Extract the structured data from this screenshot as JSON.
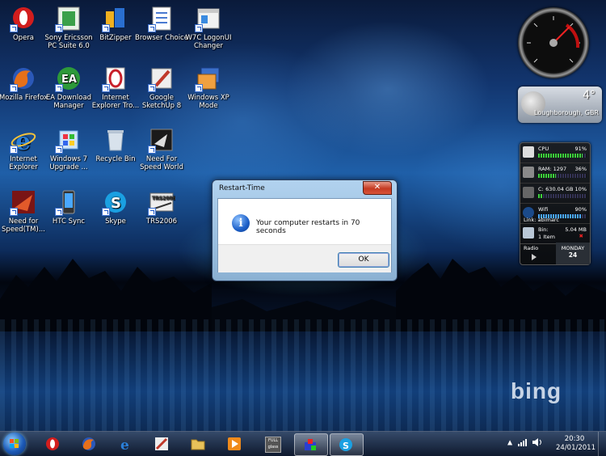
{
  "desktop": {
    "icons": [
      {
        "label": "Opera",
        "color": "#d21d1d"
      },
      {
        "label": "Sony Ericsson PC Suite 6.0",
        "color": "#3aa04a"
      },
      {
        "label": "BitZipper",
        "color": "#f0b020"
      },
      {
        "label": "Browser Choice",
        "color": "#4a7ad0"
      },
      {
        "label": "W7C LogonUI Changer",
        "color": "#c9c9c9"
      },
      {
        "label": "Mozilla Firefox",
        "color": "#e7701a"
      },
      {
        "label": "EA Download Manager",
        "color": "#2d9a3a"
      },
      {
        "label": "Internet Explorer Tro...",
        "color": "#c8202a"
      },
      {
        "label": "Google SketchUp 8",
        "color": "#c0392b"
      },
      {
        "label": "Windows XP Mode",
        "color": "#3b6fc9"
      },
      {
        "label": "Internet Explorer",
        "color": "#2a7fd8"
      },
      {
        "label": "Windows 7 Upgrade ...",
        "color": "#6fa8e8"
      },
      {
        "label": "Recycle Bin",
        "color": "#b9c7d6"
      },
      {
        "label": "Need For Speed World",
        "color": "#222222"
      },
      {
        "label": "Need for Speed(TM)...",
        "color": "#a62a2a"
      },
      {
        "label": "HTC Sync",
        "color": "#3a3a3a"
      },
      {
        "label": "Skype",
        "color": "#1aa0e2"
      },
      {
        "label": "TRS2006",
        "color": "#6a6a6a"
      }
    ],
    "bing": "bing"
  },
  "gadgets": {
    "weather": {
      "temp": "4°",
      "location": "Loughborough, GBR"
    },
    "sysmon": {
      "cpu": {
        "label": "CPU",
        "value": "91%",
        "level": 0.91
      },
      "ram": {
        "label": "RAM: 1297",
        "value": "36%",
        "level": 0.36
      },
      "disk": {
        "label": "C:",
        "value": "630.04 GB 10%",
        "level": 0.1
      },
      "wifi": {
        "label": "Wifi",
        "value": "90%",
        "level": 0.9
      },
      "link": "Link: abimarc",
      "bin": {
        "label": "Bin:",
        "size": "5.04 MB",
        "items": "1 Item"
      },
      "radio": "Radio",
      "day": "MONDAY",
      "date": "24"
    }
  },
  "dialog": {
    "title": "Restart-Time",
    "close_label": "✕",
    "message": "Your computer restarts in 70 seconds",
    "ok_label": "OK"
  },
  "taskbar": {
    "apps": [
      {
        "name": "opera",
        "color": "#d21d1d",
        "active": false
      },
      {
        "name": "firefox",
        "color": "#e7701a",
        "active": false
      },
      {
        "name": "internet-explorer",
        "color": "#2a7fd8",
        "active": false
      },
      {
        "name": "sketchup",
        "color": "#c0392b",
        "active": false
      },
      {
        "name": "explorer",
        "color": "#e8c25a",
        "active": false
      },
      {
        "name": "media-player",
        "color": "#f08a1a",
        "active": false
      },
      {
        "name": "full-glass",
        "color": "#777777",
        "active": false,
        "text": "FULL glass"
      },
      {
        "name": "restart-time",
        "color": "#d22",
        "active": true
      },
      {
        "name": "skype",
        "color": "#1aa0e2",
        "active": true
      }
    ],
    "time": "20:30",
    "date": "24/01/2011"
  }
}
